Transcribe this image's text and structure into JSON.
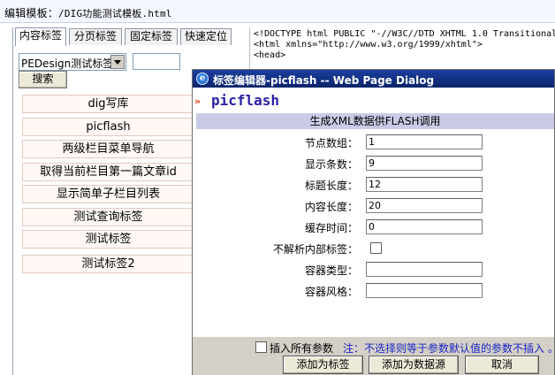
{
  "path_bar": {
    "prefix": "编辑模板：",
    "path": "/DIG功能测试模板.html"
  },
  "tabs": [
    "内容标签",
    "分页标签",
    "固定标签",
    "快速定位"
  ],
  "tag_select": {
    "value": "PEDesign测试标签"
  },
  "search_button": "搜索",
  "tag_buttons": [
    "dig写库",
    "picflash",
    "两级栏目菜单导航",
    "取得当前栏目第一篇文章id",
    "显示简单子栏目列表",
    "测试查询标签",
    "测试标签",
    "测试标签2"
  ],
  "code_lines": [
    "<!DOCTYPE html PUBLIC \"-//W3C//DTD XHTML 1.0 Transitional",
    "<html xmlns=\"http://www.w3.org/1999/xhtml\">",
    "<head>"
  ],
  "dialog": {
    "title": "标签编辑器-picflash -- Web Page Dialog",
    "tag_name": "picflash",
    "subtitle": "生成XML数据供FLASH调用",
    "fields": [
      {
        "label": "节点数组：",
        "value": "1"
      },
      {
        "label": "显示条数：",
        "value": "9"
      },
      {
        "label": "标题长度：",
        "value": "12"
      },
      {
        "label": "内容长度：",
        "value": "20"
      },
      {
        "label": "缓存时间：",
        "value": "0"
      },
      {
        "label": "不解析内部标签：",
        "checked": false
      },
      {
        "label": "容器类型：",
        "value": ""
      },
      {
        "label": "容器风格：",
        "value": ""
      }
    ],
    "insert_all": {
      "label": "插入所有参数",
      "checked": false
    },
    "note": "注：不选择则等于参数默认值的参数不插入 。",
    "buttons": [
      "添加为标签",
      "添加为数据源",
      "取消"
    ]
  }
}
